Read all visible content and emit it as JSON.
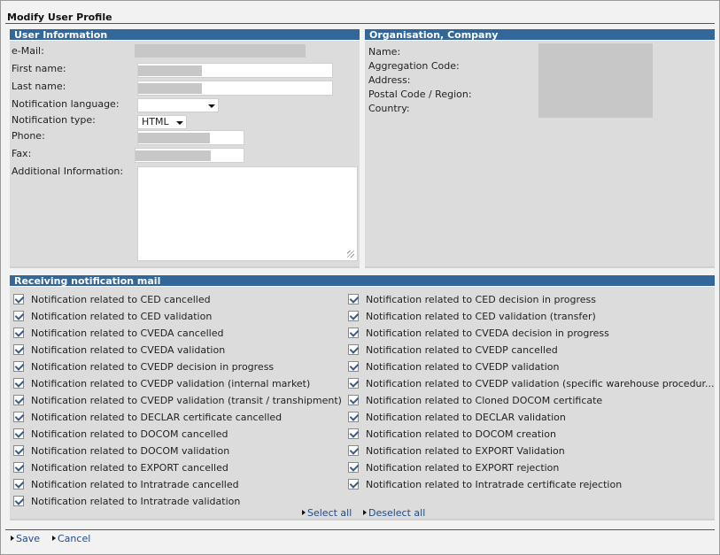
{
  "page": {
    "title": "Modify User Profile"
  },
  "user_info": {
    "header": "User Information",
    "email_label": "e-Mail:",
    "first_name_label": "First name:",
    "last_name_label": "Last name:",
    "notification_language_label": "Notification language:",
    "notification_language_value": "",
    "notification_type_label": "Notification type:",
    "notification_type_value": "HTML",
    "phone_label": "Phone:",
    "fax_label": "Fax:",
    "additional_info_label": "Additional Information:"
  },
  "organisation": {
    "header": "Organisation, Company",
    "name_label": "Name:",
    "aggregation_code_label": "Aggregation Code:",
    "address_label": "Address:",
    "postal_code_label": "Postal Code / Region:",
    "country_label": "Country:"
  },
  "notifications": {
    "header": "Receiving notification mail",
    "left": [
      "Notification related to CED cancelled",
      "Notification related to CED validation",
      "Notification related to CVEDA cancelled",
      "Notification related to CVEDA validation",
      "Notification related to CVEDP decision in progress",
      "Notification related to CVEDP validation (internal market)",
      "Notification related to CVEDP validation (transit / transhipment)",
      "Notification related to DECLAR certificate cancelled",
      "Notification related to DOCOM cancelled",
      "Notification related to DOCOM validation",
      "Notification related to EXPORT cancelled",
      "Notification related to Intratrade cancelled",
      "Notification related to Intratrade validation"
    ],
    "right": [
      "Notification related to CED decision in progress",
      "Notification related to CED validation (transfer)",
      "Notification related to CVEDA decision in progress",
      "Notification related to CVEDP cancelled",
      "Notification related to CVEDP validation",
      "Notification related to CVEDP validation (specific warehouse procedur...",
      "Notification related to Cloned DOCOM certificate",
      "Notification related to DECLAR validation",
      "Notification related to DOCOM creation",
      "Notification related to EXPORT Validation",
      "Notification related to EXPORT rejection",
      "Notification related to Intratrade certificate rejection"
    ],
    "select_all": "Select all",
    "deselect_all": "Deselect all"
  },
  "actions": {
    "save": "Save",
    "cancel": "Cancel"
  }
}
